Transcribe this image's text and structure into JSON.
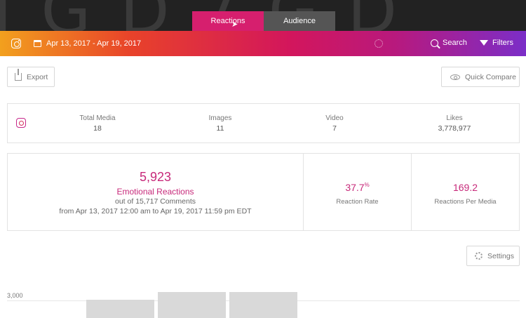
{
  "header": {
    "tabs": [
      {
        "label": "Reactions",
        "active": true
      },
      {
        "label": "Audience",
        "active": false
      }
    ],
    "date_range": "Apr 13, 2017 - Apr 19, 2017",
    "search_label": "Search",
    "filters_label": "Filters",
    "gradient_colors": [
      "#f2a01e",
      "#e8422a",
      "#d3165c",
      "#b8197d",
      "#7b2ec8"
    ]
  },
  "toolbar": {
    "export_label": "Export",
    "quick_compare_label": "Quick Compare",
    "settings_label": "Settings"
  },
  "stats": [
    {
      "label": "Total Media",
      "value": "18"
    },
    {
      "label": "Images",
      "value": "11"
    },
    {
      "label": "Video",
      "value": "7"
    },
    {
      "label": "Likes",
      "value": "3,778,977"
    }
  ],
  "reactions": {
    "count": "5,923",
    "label": "Emotional Reactions",
    "out_of": "out of 15,717 Comments",
    "period": "from Apr 13, 2017 12:00 am to Apr 19, 2017 11:59 pm EDT",
    "rate_value": "37.7",
    "rate_unit": "%",
    "rate_label": "Reaction Rate",
    "per_media_value": "169.2",
    "per_media_label": "Reactions Per Media",
    "accent_color": "#c7297a"
  },
  "chart": {
    "y_tick": "3,000"
  }
}
